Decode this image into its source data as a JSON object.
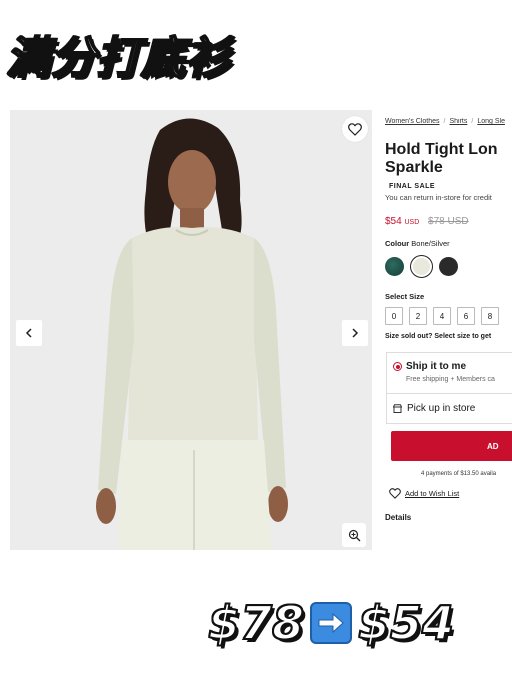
{
  "headline": "满分打底衫",
  "product": {
    "breadcrumbs": [
      "Women's Clothes",
      "Shirts",
      "Long Sle"
    ],
    "title_line1": "Hold Tight Lon",
    "title_line2": "Sparkle",
    "badge": "FINAL SALE",
    "return_note": "You can return in-store for credit",
    "price": "$54",
    "price_currency": "USD",
    "was_price": "$78 USD",
    "colour_label": "Colour",
    "colour_value": "Bone/Silver",
    "swatches": [
      "green-sparkle",
      "bone-silver",
      "black"
    ],
    "size_label": "Select Size",
    "sizes": [
      "0",
      "2",
      "4",
      "6",
      "8"
    ],
    "sold_out_note": "Size sold out? Select size to get",
    "ship_title": "Ship it to me",
    "ship_sub": "Free shipping + Members ca",
    "pickup": "Pick up in store",
    "add_button": "AD",
    "installments": "4 payments of $13.50 availa",
    "wishlist": "Add to Wish List",
    "details": "Details"
  },
  "sticker": {
    "old_price": "$78",
    "new_price": "$54"
  },
  "colors": {
    "accent_red": "#c8102e",
    "photo_bg": "#ececec",
    "shirt": "#e4e5d6"
  }
}
